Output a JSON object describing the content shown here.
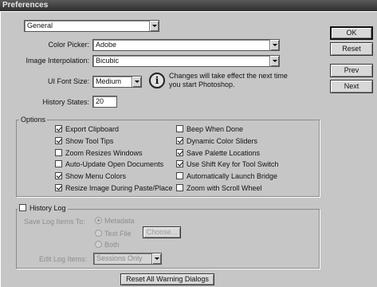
{
  "window": {
    "title": "Preferences"
  },
  "section_select": {
    "value": "General"
  },
  "fields": {
    "color_picker": {
      "label": "Color Picker:",
      "value": "Adobe"
    },
    "image_interpolation": {
      "label": "Image Interpolation:",
      "value": "Bicubic"
    },
    "ui_font_size": {
      "label": "UI Font Size:",
      "value": "Medium"
    },
    "font_note": "Changes will take effect the next time you start Photoshop.",
    "history_states": {
      "label": "History States:",
      "value": "20"
    }
  },
  "options": {
    "title": "Options",
    "left": [
      {
        "label": "Export Clipboard",
        "checked": true
      },
      {
        "label": "Show Tool Tips",
        "checked": true
      },
      {
        "label": "Zoom Resizes Windows",
        "checked": false
      },
      {
        "label": "Auto-Update Open Documents",
        "checked": false
      },
      {
        "label": "Show Menu Colors",
        "checked": true
      },
      {
        "label": "Resize Image During Paste/Place",
        "checked": true
      }
    ],
    "right": [
      {
        "label": "Beep When Done",
        "checked": false
      },
      {
        "label": "Dynamic Color Sliders",
        "checked": true
      },
      {
        "label": "Save Palette Locations",
        "checked": true
      },
      {
        "label": "Use Shift Key for Tool Switch",
        "checked": true
      },
      {
        "label": "Automatically Launch Bridge",
        "checked": false
      },
      {
        "label": "Zoom with Scroll Wheel",
        "checked": false
      }
    ]
  },
  "history_log": {
    "label": "History Log",
    "checked": false,
    "save_label": "Save Log Items To:",
    "radios": [
      {
        "label": "Metadata",
        "selected": true
      },
      {
        "label": "Text File",
        "selected": false
      },
      {
        "label": "Both",
        "selected": false
      }
    ],
    "choose_label": "Choose...",
    "edit_label": "Edit Log Items:",
    "edit_value": "Sessions Only"
  },
  "reset_warnings_label": "Reset All Warning Dialogs",
  "buttons": {
    "ok": "OK",
    "reset": "Reset",
    "prev": "Prev",
    "next": "Next"
  }
}
